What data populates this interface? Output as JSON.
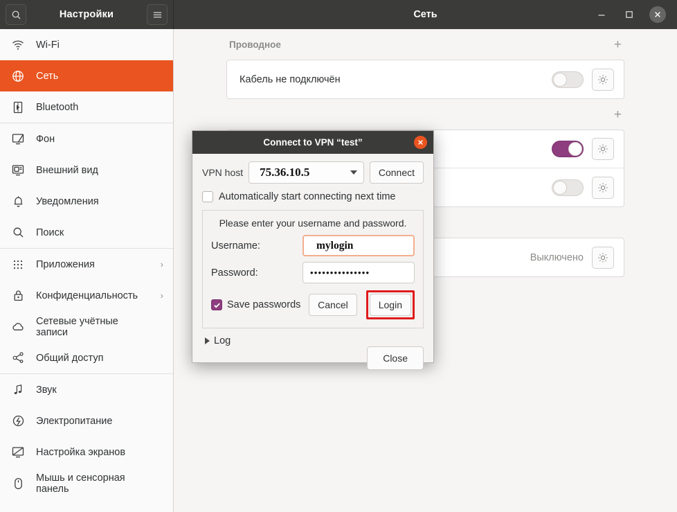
{
  "window": {
    "sidebar_title": "Настройки",
    "main_title": "Сеть",
    "search_icon": "search-icon",
    "menu_icon": "hamburger-menu-icon",
    "minimize_label": "—",
    "maximize_label": "□",
    "close_label": "✕",
    "accent_color": "#e95420",
    "titlebar_color": "#3b3b39"
  },
  "sidebar": {
    "items": [
      {
        "label": "Wi-Fi",
        "icon": "wifi-icon",
        "active": false,
        "chevron": ""
      },
      {
        "label": "Сеть",
        "icon": "network-globe-icon",
        "active": true,
        "chevron": ""
      },
      {
        "label": "Bluetooth",
        "icon": "bluetooth-icon",
        "active": false,
        "chevron": ""
      },
      {
        "label": "Фон",
        "icon": "wallpaper-icon",
        "active": false,
        "chevron": ""
      },
      {
        "label": "Внешний вид",
        "icon": "appearance-icon",
        "active": false,
        "chevron": ""
      },
      {
        "label": "Уведомления",
        "icon": "bell-icon",
        "active": false,
        "chevron": ""
      },
      {
        "label": "Поиск",
        "icon": "search-icon",
        "active": false,
        "chevron": ""
      },
      {
        "label": "Приложения",
        "icon": "apps-grid-icon",
        "active": false,
        "chevron": "›"
      },
      {
        "label": "Конфиденциальность",
        "icon": "lock-icon",
        "active": false,
        "chevron": "›"
      },
      {
        "label": "Сетевые учётные записи",
        "icon": "cloud-icon",
        "active": false,
        "chevron": ""
      },
      {
        "label": "Общий доступ",
        "icon": "share-icon",
        "active": false,
        "chevron": ""
      },
      {
        "label": "Звук",
        "icon": "music-note-icon",
        "active": false,
        "chevron": ""
      },
      {
        "label": "Электропитание",
        "icon": "power-icon",
        "active": false,
        "chevron": ""
      },
      {
        "label": "Настройка экранов",
        "icon": "display-icon",
        "active": false,
        "chevron": ""
      },
      {
        "label": "Мышь и сенсорная панель",
        "icon": "mouse-icon",
        "active": false,
        "chevron": ""
      }
    ]
  },
  "main": {
    "sections": [
      {
        "title": "Проводное",
        "add_label": "+",
        "rows": [
          {
            "label": "Кабель не подключён",
            "status": "",
            "toggle": "off",
            "gear": "gear-icon"
          }
        ]
      },
      {
        "title": "",
        "add_label": "+",
        "rows": [
          {
            "label": "",
            "status": "",
            "toggle": "on",
            "gear": "gear-icon"
          },
          {
            "label": "",
            "status": "",
            "toggle": "off",
            "gear": "gear-icon"
          }
        ]
      },
      {
        "title": "",
        "add_label": "",
        "rows": [
          {
            "label": "",
            "status": "Выключено",
            "toggle": "none",
            "gear": "gear-icon"
          }
        ]
      }
    ]
  },
  "dialog": {
    "title": "Connect to VPN “test”",
    "close_label": "✕",
    "host_label": "VPN host",
    "host_value": "75.36.10.5",
    "connect_label": "Connect",
    "auto_start_label": "Automatically start connecting next time",
    "auto_start_checked": false,
    "prompt": "Please enter your username and password.",
    "username_label": "Username:",
    "username_value": "mylogin",
    "password_label": "Password:",
    "password_value": "•••••••••••••••",
    "save_passwords_label": "Save passwords",
    "save_passwords_checked": true,
    "cancel_label": "Cancel",
    "login_label": "Login",
    "login_highlight_color": "#e01b1b",
    "log_label": "Log",
    "close_button_label": "Close"
  }
}
